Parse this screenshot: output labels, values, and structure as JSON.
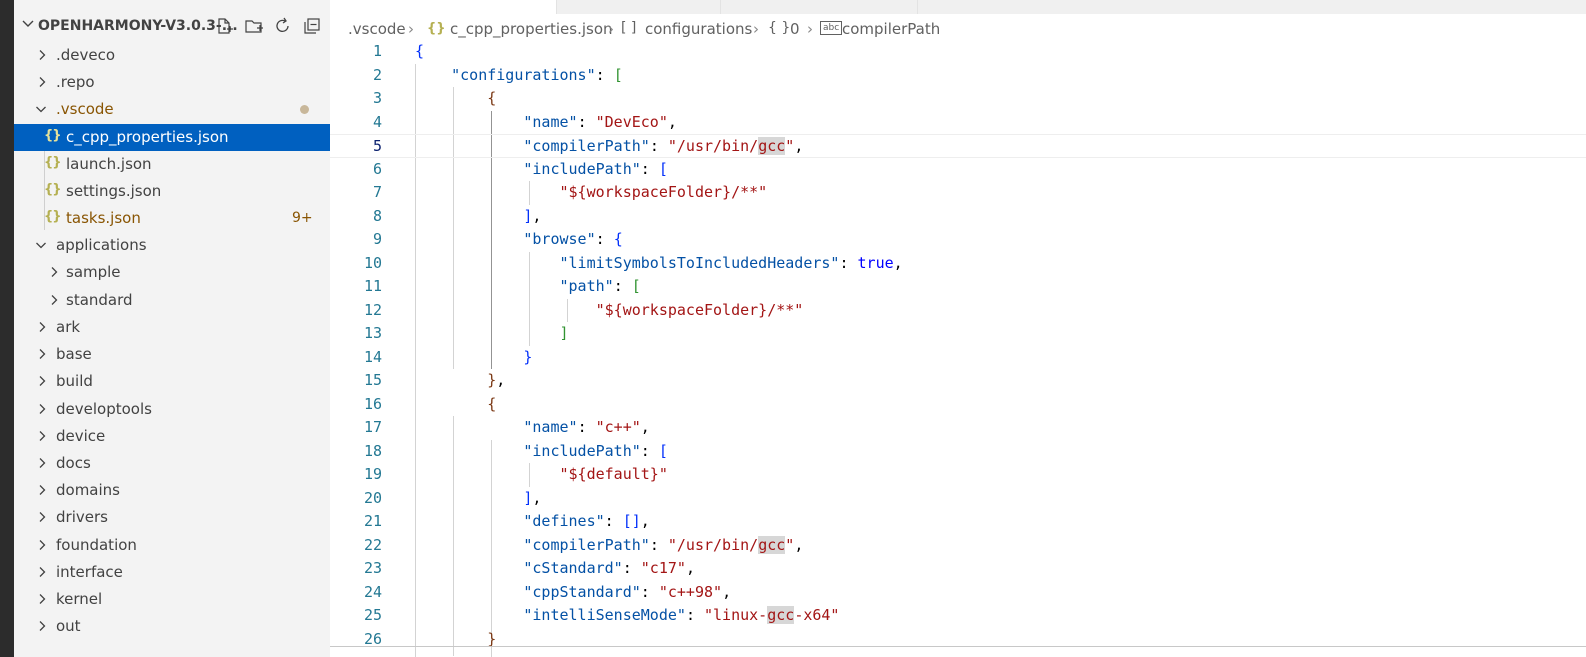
{
  "explorer": {
    "title": "OPENHARMONY-V3.0.3-...",
    "actions": [
      "new-file",
      "new-folder",
      "refresh",
      "collapse-all"
    ],
    "items": [
      {
        "label": ".deveco"
      },
      {
        "label": ".repo"
      },
      {
        "label": ".vscode"
      },
      {
        "label": "c_cpp_properties.json"
      },
      {
        "label": "launch.json"
      },
      {
        "label": "settings.json"
      },
      {
        "label": "tasks.json",
        "badge": "9+"
      },
      {
        "label": "applications"
      },
      {
        "label": "sample"
      },
      {
        "label": "standard"
      },
      {
        "label": "ark"
      },
      {
        "label": "base"
      },
      {
        "label": "build"
      },
      {
        "label": "developtools"
      },
      {
        "label": "device"
      },
      {
        "label": "docs"
      },
      {
        "label": "domains"
      },
      {
        "label": "drivers"
      },
      {
        "label": "foundation"
      },
      {
        "label": "interface"
      },
      {
        "label": "kernel"
      },
      {
        "label": "out"
      }
    ],
    "json_icon": "{}"
  },
  "breadcrumb": {
    "folder": ".vscode",
    "file": "c_cpp_properties.json",
    "seg1": "configurations",
    "seg2": "0",
    "seg3": "compilerPath",
    "file_icon": "{}",
    "array_icon": "[ ]",
    "object_icon": "{ }",
    "string_icon": "abc"
  },
  "editor": {
    "current_line": 5,
    "line_numbers": [
      "1",
      "2",
      "3",
      "4",
      "5",
      "6",
      "7",
      "8",
      "9",
      "10",
      "11",
      "12",
      "13",
      "14",
      "15",
      "16",
      "17",
      "18",
      "19",
      "20",
      "21",
      "22",
      "23",
      "24",
      "25",
      "26"
    ],
    "highlight_word": "gcc",
    "tokens": {
      "configurations": "\"configurations\"",
      "name": "\"name\"",
      "deveco": "\"DevEco\"",
      "compilerPath": "\"compilerPath\"",
      "usrbin": "\"/usr/bin/",
      "gcc": "gcc",
      "quote": "\"",
      "includePath": "\"includePath\"",
      "workspace": "\"${workspaceFolder}/**\"",
      "browse": "\"browse\"",
      "limitSymbols": "\"limitSymbolsToIncludedHeaders\"",
      "true": "true",
      "path": "\"path\"",
      "cpp_name": "\"c++\"",
      "default": "\"${default}\"",
      "defines": "\"defines\"",
      "cStandard": "\"cStandard\"",
      "c17": "\"c17\"",
      "cppStandard": "\"cppStandard\"",
      "cpp98": "\"c++98\"",
      "intelliSenseMode": "\"intelliSenseMode\"",
      "linux": "\"linux-",
      "x64": "-x64\""
    }
  }
}
